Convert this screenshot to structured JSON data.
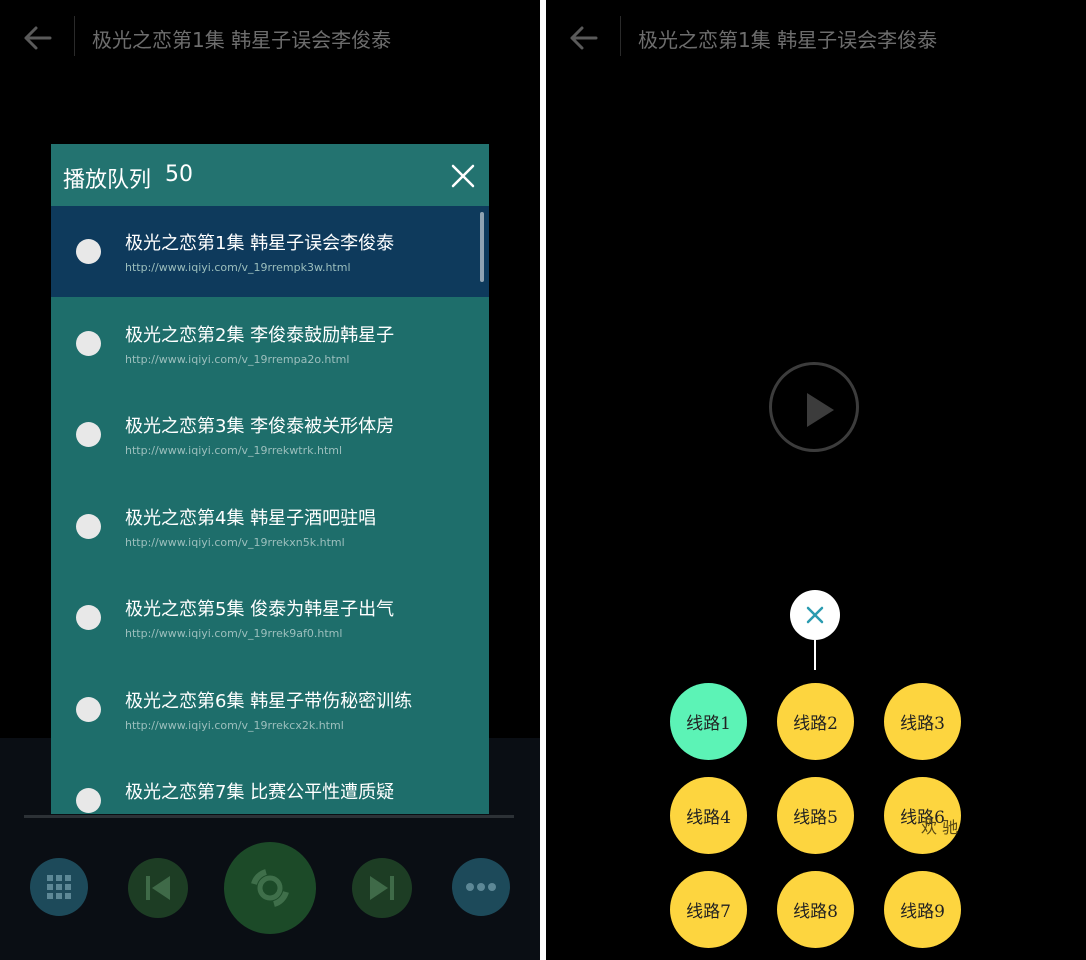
{
  "video_title": "极光之恋第1集 韩星子误会李俊泰",
  "queue": {
    "title": "播放队列",
    "count": "50",
    "items": [
      {
        "name": "极光之恋第1集 韩星子误会李俊泰",
        "url": "http://www.iqiyi.com/v_19rrempk3w.html",
        "active": true
      },
      {
        "name": "极光之恋第2集 李俊泰鼓励韩星子",
        "url": "http://www.iqiyi.com/v_19rrempa2o.html"
      },
      {
        "name": "极光之恋第3集 李俊泰被关形体房",
        "url": "http://www.iqiyi.com/v_19rrekwtrk.html"
      },
      {
        "name": "极光之恋第4集 韩星子酒吧驻唱",
        "url": "http://www.iqiyi.com/v_19rrekxn5k.html"
      },
      {
        "name": "极光之恋第5集 俊泰为韩星子出气",
        "url": "http://www.iqiyi.com/v_19rrek9af0.html"
      },
      {
        "name": "极光之恋第6集 韩星子带伤秘密训练",
        "url": "http://www.iqiyi.com/v_19rrekcx2k.html"
      },
      {
        "name": "极光之恋第7集 比赛公平性遭质疑",
        "url": ""
      }
    ]
  },
  "routes": [
    "线路1",
    "线路2",
    "线路3",
    "线路4",
    "线路5",
    "线路6",
    "线路7",
    "线路8",
    "线路9"
  ],
  "overlap_text": "欢 驰",
  "colors": {
    "queue_bg": "#1e6e6b",
    "active_item": "#0e3a5c",
    "route_yellow": "#fdd53f",
    "route_active": "#5cf3b6"
  }
}
